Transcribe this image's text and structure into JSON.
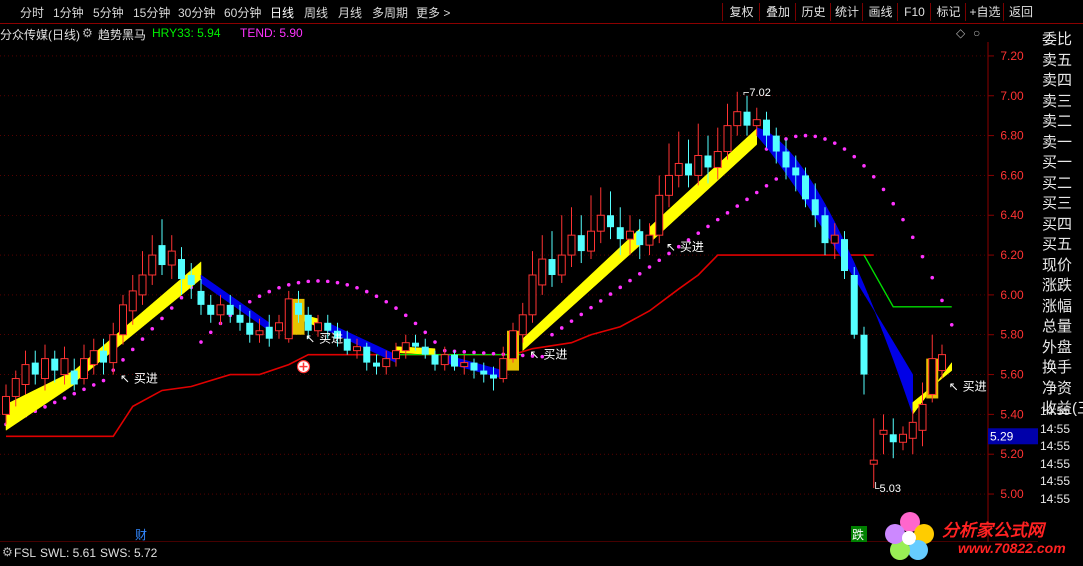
{
  "periods": [
    "分时",
    "1分钟",
    "5分钟",
    "15分钟",
    "30分钟",
    "60分钟",
    "日线",
    "周线",
    "月线",
    "多周期",
    "更多 >"
  ],
  "active_period": "日线",
  "toolbar_right": [
    "复权",
    "叠加",
    "历史",
    "统计",
    "画线",
    "F10",
    "标记",
    "+自选",
    "返回"
  ],
  "info": {
    "stock": "分众传媒(日线)",
    "indicator": "趋势黑马",
    "hry": "HRY33: 5.94",
    "tend": "TEND: 5.90"
  },
  "colors": {
    "up": "#ff3333",
    "down": "#54ffff",
    "yellow_band": "#ffff00",
    "blue_band": "#0000e6",
    "magenta_dots": "#ff33ff",
    "red_line": "#e00000",
    "green_line": "#00dd00",
    "grid": "#8b0000"
  },
  "price_axis": [
    "7.20",
    "7.00",
    "6.80",
    "6.60",
    "6.40",
    "6.20",
    "6.00",
    "5.80",
    "5.60",
    "5.40",
    "5.20",
    "5.00"
  ],
  "current_price_tag": "5.29",
  "price_annotations": {
    "high": "7.02",
    "low": "5.03"
  },
  "signal_label": "买进",
  "markers": {
    "finance": "财",
    "fall": "跌"
  },
  "side_items": [
    "委比",
    "卖五",
    "卖四",
    "卖三",
    "卖二",
    "卖一",
    "买一",
    "买二",
    "买三",
    "买四",
    "买五",
    "现价",
    "涨跌",
    "涨幅",
    "总量",
    "外盘",
    "换手",
    "净资",
    "收益(三)"
  ],
  "side_times": [
    "14:55",
    "14:55",
    "14:55",
    "14:55",
    "14:55",
    "14:55"
  ],
  "bottom": {
    "fsl": "FSL",
    "swl": "SWL: 5.61",
    "sws": "SWS: 5.72"
  },
  "watermark": {
    "title": "分析家公式网",
    "url": "www.70822.com"
  },
  "chart_data": {
    "type": "candlestick",
    "ylim": [
      4.96,
      7.27
    ],
    "candles": [
      {
        "o": 5.4,
        "c": 5.49,
        "h": 5.55,
        "l": 5.35
      },
      {
        "o": 5.49,
        "c": 5.58,
        "h": 5.62,
        "l": 5.44
      },
      {
        "o": 5.55,
        "c": 5.65,
        "h": 5.72,
        "l": 5.5
      },
      {
        "o": 5.66,
        "c": 5.6,
        "h": 5.72,
        "l": 5.55
      },
      {
        "o": 5.58,
        "c": 5.68,
        "h": 5.75,
        "l": 5.52
      },
      {
        "o": 5.68,
        "c": 5.62,
        "h": 5.72,
        "l": 5.56
      },
      {
        "o": 5.6,
        "c": 5.68,
        "h": 5.74,
        "l": 5.55
      },
      {
        "o": 5.62,
        "c": 5.55,
        "h": 5.68,
        "l": 5.52
      },
      {
        "o": 5.58,
        "c": 5.68,
        "h": 5.75,
        "l": 5.55
      },
      {
        "o": 5.65,
        "c": 5.72,
        "h": 5.78,
        "l": 5.6
      },
      {
        "o": 5.72,
        "c": 5.66,
        "h": 5.78,
        "l": 5.6
      },
      {
        "o": 5.66,
        "c": 5.8,
        "h": 5.86,
        "l": 5.6
      },
      {
        "o": 5.8,
        "c": 5.95,
        "h": 6.0,
        "l": 5.75
      },
      {
        "o": 5.92,
        "c": 6.02,
        "h": 6.1,
        "l": 5.85
      },
      {
        "o": 6.0,
        "c": 6.1,
        "h": 6.22,
        "l": 5.95
      },
      {
        "o": 6.1,
        "c": 6.2,
        "h": 6.3,
        "l": 6.05
      },
      {
        "o": 6.25,
        "c": 6.15,
        "h": 6.38,
        "l": 6.1
      },
      {
        "o": 6.15,
        "c": 6.22,
        "h": 6.3,
        "l": 6.08
      },
      {
        "o": 6.18,
        "c": 6.08,
        "h": 6.24,
        "l": 6.0
      },
      {
        "o": 6.1,
        "c": 6.05,
        "h": 6.16,
        "l": 5.98
      },
      {
        "o": 6.02,
        "c": 5.95,
        "h": 6.08,
        "l": 5.9
      },
      {
        "o": 5.95,
        "c": 5.9,
        "h": 6.0,
        "l": 5.86
      },
      {
        "o": 5.9,
        "c": 5.95,
        "h": 6.0,
        "l": 5.85
      },
      {
        "o": 5.95,
        "c": 5.9,
        "h": 6.0,
        "l": 5.86
      },
      {
        "o": 5.9,
        "c": 5.86,
        "h": 5.95,
        "l": 5.82
      },
      {
        "o": 5.86,
        "c": 5.8,
        "h": 5.92,
        "l": 5.76
      },
      {
        "o": 5.8,
        "c": 5.82,
        "h": 5.88,
        "l": 5.76
      },
      {
        "o": 5.84,
        "c": 5.78,
        "h": 5.9,
        "l": 5.74
      },
      {
        "o": 5.82,
        "c": 5.86,
        "h": 5.9,
        "l": 5.78
      },
      {
        "o": 5.78,
        "c": 5.98,
        "h": 6.02,
        "l": 5.76
      },
      {
        "o": 5.96,
        "c": 5.9,
        "h": 6.02,
        "l": 5.86
      },
      {
        "o": 5.9,
        "c": 5.82,
        "h": 5.94,
        "l": 5.78
      },
      {
        "o": 5.82,
        "c": 5.86,
        "h": 5.9,
        "l": 5.79
      },
      {
        "o": 5.86,
        "c": 5.82,
        "h": 5.9,
        "l": 5.78
      },
      {
        "o": 5.82,
        "c": 5.78,
        "h": 5.86,
        "l": 5.74
      },
      {
        "o": 5.78,
        "c": 5.72,
        "h": 5.82,
        "l": 5.7
      },
      {
        "o": 5.72,
        "c": 5.74,
        "h": 5.78,
        "l": 5.68
      },
      {
        "o": 5.74,
        "c": 5.66,
        "h": 5.76,
        "l": 5.62
      },
      {
        "o": 5.66,
        "c": 5.64,
        "h": 5.7,
        "l": 5.6
      },
      {
        "o": 5.64,
        "c": 5.68,
        "h": 5.72,
        "l": 5.6
      },
      {
        "o": 5.68,
        "c": 5.72,
        "h": 5.76,
        "l": 5.64
      },
      {
        "o": 5.72,
        "c": 5.76,
        "h": 5.8,
        "l": 5.68
      },
      {
        "o": 5.76,
        "c": 5.74,
        "h": 5.8,
        "l": 5.72
      },
      {
        "o": 5.74,
        "c": 5.7,
        "h": 5.78,
        "l": 5.68
      },
      {
        "o": 5.7,
        "c": 5.65,
        "h": 5.72,
        "l": 5.62
      },
      {
        "o": 5.65,
        "c": 5.7,
        "h": 5.74,
        "l": 5.62
      },
      {
        "o": 5.7,
        "c": 5.64,
        "h": 5.72,
        "l": 5.62
      },
      {
        "o": 5.64,
        "c": 5.66,
        "h": 5.7,
        "l": 5.6
      },
      {
        "o": 5.66,
        "c": 5.62,
        "h": 5.68,
        "l": 5.58
      },
      {
        "o": 5.62,
        "c": 5.6,
        "h": 5.66,
        "l": 5.56
      },
      {
        "o": 5.6,
        "c": 5.58,
        "h": 5.64,
        "l": 5.52
      },
      {
        "o": 5.58,
        "c": 5.68,
        "h": 5.74,
        "l": 5.56
      },
      {
        "o": 5.68,
        "c": 5.82,
        "h": 5.86,
        "l": 5.66
      },
      {
        "o": 5.8,
        "c": 5.9,
        "h": 5.96,
        "l": 5.76
      },
      {
        "o": 5.9,
        "c": 6.1,
        "h": 6.22,
        "l": 5.86
      },
      {
        "o": 6.05,
        "c": 6.18,
        "h": 6.3,
        "l": 6.0
      },
      {
        "o": 6.18,
        "c": 6.1,
        "h": 6.32,
        "l": 6.04
      },
      {
        "o": 6.1,
        "c": 6.2,
        "h": 6.4,
        "l": 6.06
      },
      {
        "o": 6.2,
        "c": 6.3,
        "h": 6.44,
        "l": 6.14
      },
      {
        "o": 6.3,
        "c": 6.22,
        "h": 6.4,
        "l": 6.16
      },
      {
        "o": 6.22,
        "c": 6.32,
        "h": 6.5,
        "l": 6.18
      },
      {
        "o": 6.32,
        "c": 6.4,
        "h": 6.54,
        "l": 6.26
      },
      {
        "o": 6.4,
        "c": 6.34,
        "h": 6.52,
        "l": 6.28
      },
      {
        "o": 6.34,
        "c": 6.28,
        "h": 6.44,
        "l": 6.2
      },
      {
        "o": 6.28,
        "c": 6.32,
        "h": 6.4,
        "l": 6.2
      },
      {
        "o": 6.32,
        "c": 6.25,
        "h": 6.38,
        "l": 6.18
      },
      {
        "o": 6.25,
        "c": 6.3,
        "h": 6.36,
        "l": 6.2
      },
      {
        "o": 6.3,
        "c": 6.5,
        "h": 6.6,
        "l": 6.26
      },
      {
        "o": 6.5,
        "c": 6.6,
        "h": 6.76,
        "l": 6.44
      },
      {
        "o": 6.6,
        "c": 6.66,
        "h": 6.82,
        "l": 6.54
      },
      {
        "o": 6.66,
        "c": 6.6,
        "h": 6.78,
        "l": 6.54
      },
      {
        "o": 6.6,
        "c": 6.7,
        "h": 6.86,
        "l": 6.55
      },
      {
        "o": 6.7,
        "c": 6.64,
        "h": 6.8,
        "l": 6.56
      },
      {
        "o": 6.64,
        "c": 6.72,
        "h": 6.84,
        "l": 6.58
      },
      {
        "o": 6.72,
        "c": 6.85,
        "h": 6.96,
        "l": 6.68
      },
      {
        "o": 6.85,
        "c": 6.92,
        "h": 7.02,
        "l": 6.8
      },
      {
        "o": 6.92,
        "c": 6.85,
        "h": 7.0,
        "l": 6.8
      },
      {
        "o": 6.85,
        "c": 6.88,
        "h": 6.94,
        "l": 6.8
      },
      {
        "o": 6.88,
        "c": 6.8,
        "h": 6.92,
        "l": 6.74
      },
      {
        "o": 6.8,
        "c": 6.72,
        "h": 6.84,
        "l": 6.66
      },
      {
        "o": 6.72,
        "c": 6.64,
        "h": 6.78,
        "l": 6.58
      },
      {
        "o": 6.64,
        "c": 6.6,
        "h": 6.7,
        "l": 6.52
      },
      {
        "o": 6.6,
        "c": 6.48,
        "h": 6.64,
        "l": 6.44
      },
      {
        "o": 6.48,
        "c": 6.4,
        "h": 6.56,
        "l": 6.34
      },
      {
        "o": 6.4,
        "c": 6.26,
        "h": 6.44,
        "l": 6.2
      },
      {
        "o": 6.26,
        "c": 6.3,
        "h": 6.36,
        "l": 6.18
      },
      {
        "o": 6.28,
        "c": 6.12,
        "h": 6.32,
        "l": 6.08
      },
      {
        "o": 6.1,
        "c": 5.8,
        "h": 6.14,
        "l": 5.78
      },
      {
        "o": 5.8,
        "c": 5.6,
        "h": 5.84,
        "l": 5.5
      },
      {
        "o": 5.15,
        "c": 5.17,
        "h": 5.38,
        "l": 5.03
      },
      {
        "o": 5.3,
        "c": 5.32,
        "h": 5.4,
        "l": 5.2
      },
      {
        "o": 5.3,
        "c": 5.26,
        "h": 5.38,
        "l": 5.18
      },
      {
        "o": 5.26,
        "c": 5.3,
        "h": 5.34,
        "l": 5.22
      },
      {
        "o": 5.28,
        "c": 5.36,
        "h": 5.42,
        "l": 5.2
      },
      {
        "o": 5.32,
        "c": 5.45,
        "h": 5.56,
        "l": 5.24
      },
      {
        "o": 5.5,
        "c": 5.68,
        "h": 5.8,
        "l": 5.46
      },
      {
        "o": 5.62,
        "c": 5.7,
        "h": 5.75,
        "l": 5.58
      }
    ]
  }
}
